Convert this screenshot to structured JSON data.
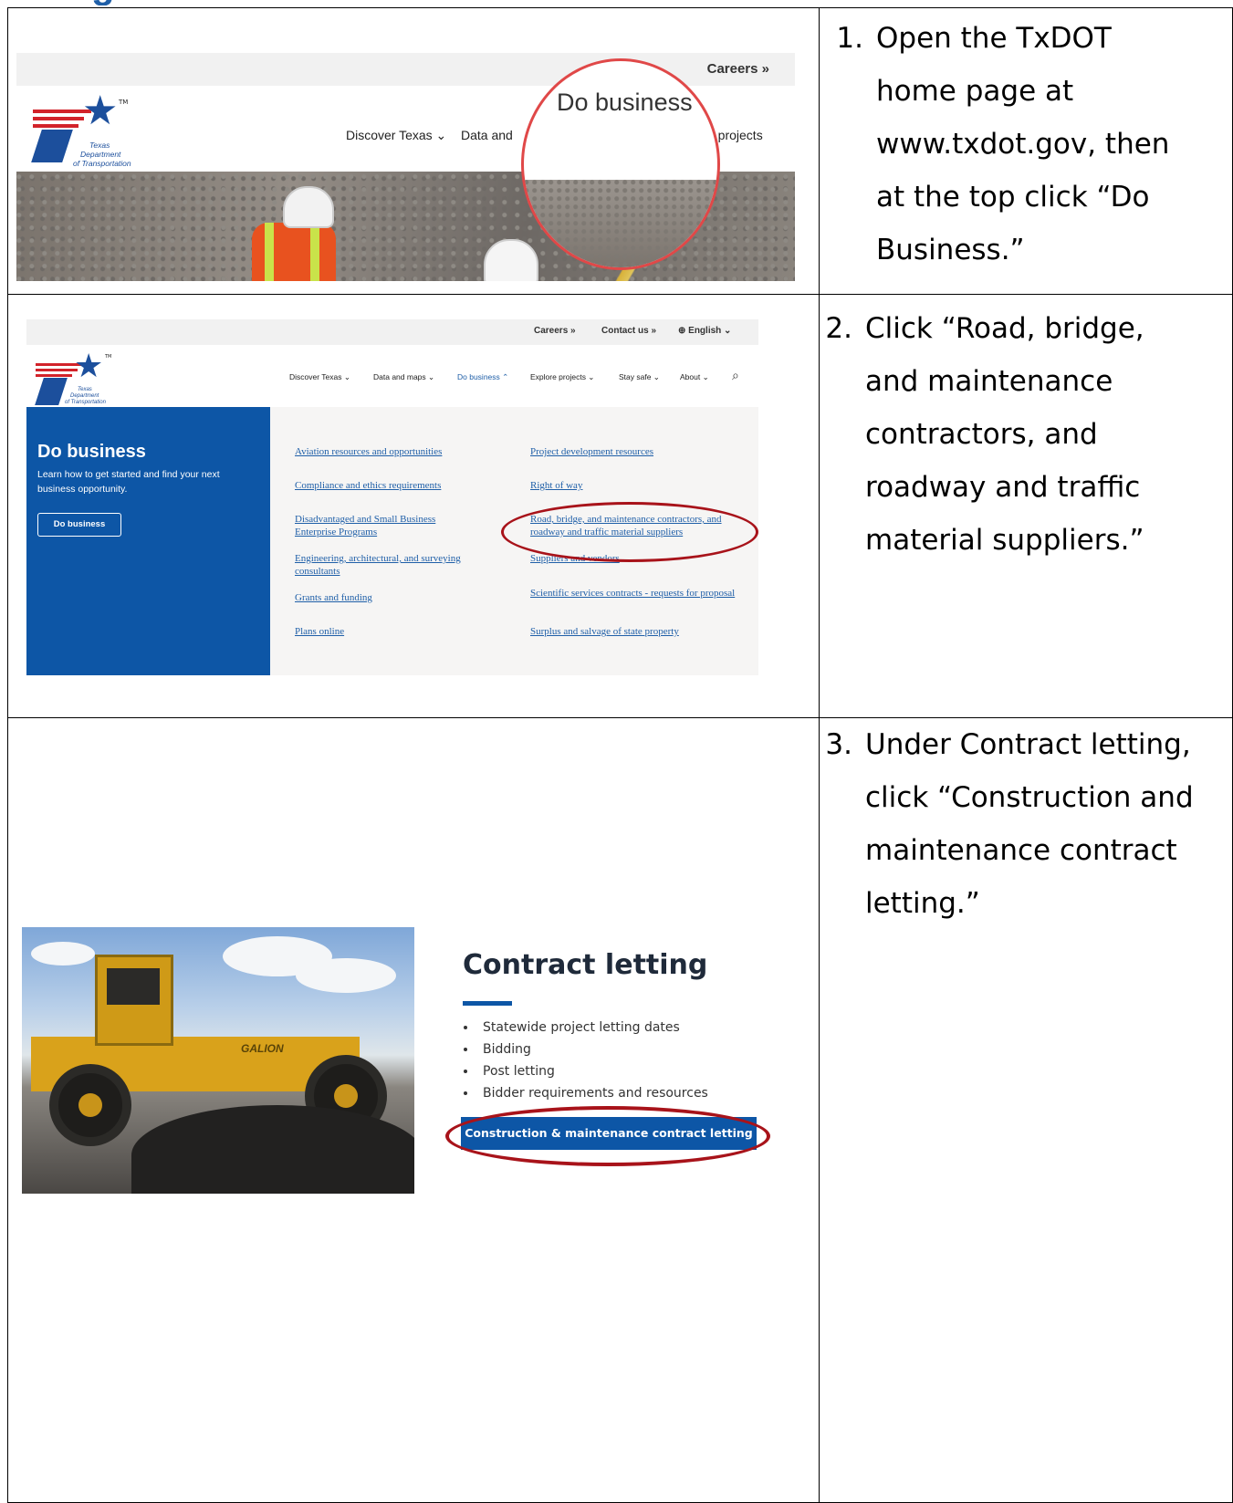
{
  "heading_fragment": "g",
  "steps": [
    {
      "number": "1.",
      "lines": [
        "Open the TxDOT",
        "home page at",
        "www.txdot.gov, then",
        "at the top click  “Do",
        "Business.”"
      ],
      "screenshot": {
        "utility": {
          "careers": "Careers »"
        },
        "nav": [
          "Discover Texas ⌄",
          "Data and",
          "e projects"
        ],
        "zoom_text": "Do business",
        "logo_lines": [
          "Texas",
          "Department",
          "of Transportation"
        ],
        "logo_tm": "TM"
      }
    },
    {
      "number": "2.",
      "lines": [
        "Click “Road, bridge,",
        "and maintenance",
        "contractors, and",
        "roadway and traffic",
        "material suppliers.”"
      ],
      "screenshot": {
        "utility": [
          "Careers »",
          "Contact us »",
          "⊕ English ⌄"
        ],
        "nav": [
          "Discover Texas ⌄",
          "Data and maps ⌄",
          "Do business ⌃",
          "Explore projects ⌄",
          "Stay safe ⌄",
          "About ⌄"
        ],
        "search_icon": "⌕",
        "panel_title": "Do business",
        "panel_desc": "Learn how to get started and find your next business opportunity.",
        "panel_button": "Do business",
        "links_left": [
          "Aviation resources and opportunities",
          "Compliance and ethics requirements",
          "Disadvantaged and Small Business Enterprise Programs",
          "Engineering, architectural, and surveying consultants",
          "Grants and funding",
          "Plans online"
        ],
        "links_right": [
          "Project development resources",
          "Right of way",
          "Road, bridge, and maintenance contractors, and roadway and traffic material suppliers",
          "Suppliers and vendors",
          "Scientific services contracts - requests for proposal",
          "Surplus and salvage of state property"
        ],
        "logo_lines": [
          "Texas",
          "Department",
          "of Transportation"
        ],
        "logo_tm": "TM"
      }
    },
    {
      "number": "3.",
      "lines": [
        "Under Contract letting,",
        "click “Construction and",
        "maintenance contract",
        "letting.”"
      ],
      "screenshot": {
        "title": "Contract letting",
        "bullets": [
          "Statewide project letting dates",
          "Bidding",
          "Post letting",
          "Bidder requirements and resources"
        ],
        "button": "Construction & maintenance contract letting",
        "machine_label": "GALION"
      }
    }
  ],
  "colors": {
    "txdot_blue": "#0d56a6",
    "highlight_red": "#a8131a",
    "magnifier_red": "#e04848"
  }
}
